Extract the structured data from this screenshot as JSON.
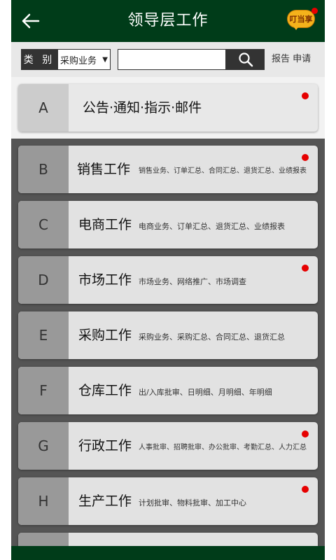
{
  "header": {
    "title": "领导层工作",
    "logo_text": "叮当享",
    "back_icon": "arrow-left-icon"
  },
  "search": {
    "category_label": "类 别",
    "category_value": "采购业务",
    "input_value": "",
    "input_placeholder": "",
    "report_label": "报告 申请"
  },
  "notice": {
    "letter": "A",
    "name": "公告·通知·指示·邮件",
    "has_badge": true
  },
  "modules": [
    {
      "letter": "B",
      "name": "销售工作",
      "desc": "销售业务、订单汇总、合同汇总、退货汇总、业绩报表",
      "has_badge": true
    },
    {
      "letter": "C",
      "name": "电商工作",
      "desc": "电商业务、订单汇总、退货汇总、业绩报表",
      "has_badge": false
    },
    {
      "letter": "D",
      "name": "市场工作",
      "desc": "市场业务、网络推广、市场调查",
      "has_badge": true
    },
    {
      "letter": "E",
      "name": "采购工作",
      "desc": "采购业务、采购汇总、合同汇总、退货汇总",
      "has_badge": false
    },
    {
      "letter": "F",
      "name": "仓库工作",
      "desc": "出/入库批审、日明细、月明细、年明细",
      "has_badge": false
    },
    {
      "letter": "G",
      "name": "行政工作",
      "desc": "人事批审、招聘批审、办公批审、考勤汇总、人力汇总",
      "has_badge": true
    },
    {
      "letter": "H",
      "name": "生产工作",
      "desc": "计划批审、物料批审、加工中心",
      "has_badge": true
    },
    {
      "letter": "",
      "name": "",
      "desc": "",
      "has_badge": false
    }
  ],
  "colors": {
    "header_bg": "#003c19",
    "badge": "#e60000",
    "list_bg": "#555555"
  }
}
